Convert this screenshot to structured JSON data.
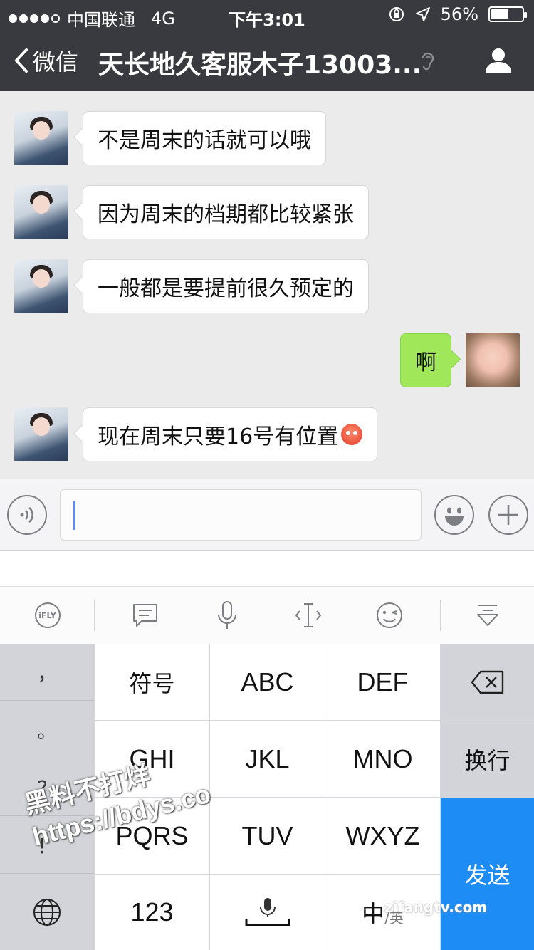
{
  "status_bar": {
    "carrier": "中国联通",
    "network": "4G",
    "time": "下午3:01",
    "battery": "56%",
    "battery_level": 0.56
  },
  "nav": {
    "back_label": "微信",
    "chat_title": "天长地久客服木子13003..."
  },
  "messages": [
    {
      "side": "left",
      "text": "不是周末的话就可以哦"
    },
    {
      "side": "left",
      "text": "因为周末的档期都比较紧张"
    },
    {
      "side": "left",
      "text": "一般都是要提前很久预定的"
    },
    {
      "side": "right",
      "text": "啊"
    },
    {
      "side": "left",
      "text": "现在周末只要16号有位置",
      "emoji": "flushed-face"
    }
  ],
  "input": {
    "value": "",
    "placeholder": ""
  },
  "keyboard_toolbar": {
    "ifly": "iFLY"
  },
  "keyboard": {
    "left_column": [
      "，",
      "。",
      "？",
      "！"
    ],
    "rows": [
      [
        "符号",
        "ABC",
        "DEF"
      ],
      [
        "GHI",
        "JKL",
        "MNO"
      ],
      [
        "PQRS",
        "TUV",
        "WXYZ"
      ]
    ],
    "key_123": "123",
    "key_lang_main": "中",
    "key_lang_alt": "/英",
    "key_newline": "换行",
    "key_send": "发送"
  },
  "watermarks": {
    "line1": "黑料不打烊",
    "line2": "https://bdys.co",
    "corner": "zifangtv.com"
  },
  "colors": {
    "nav_bg": "#393a3f",
    "chat_bg": "#ebebeb",
    "sent_bubble": "#a0e75a",
    "send_key": "#1d8df5"
  }
}
